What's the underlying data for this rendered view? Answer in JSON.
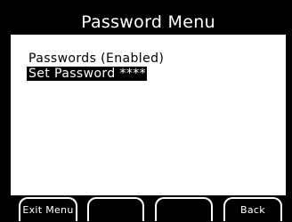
{
  "header": {
    "title": "Password Menu"
  },
  "menu": {
    "items": [
      {
        "label": "Passwords (Enabled)",
        "selected": false
      },
      {
        "label": "Set Password ****",
        "selected": true
      }
    ]
  },
  "softkeys": [
    {
      "label": "Exit Menu"
    },
    {
      "label": ""
    },
    {
      "label": ""
    },
    {
      "label": "Back"
    }
  ]
}
